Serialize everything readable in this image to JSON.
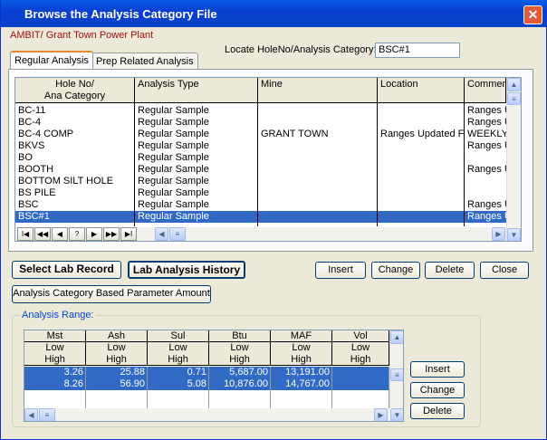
{
  "window": {
    "title": "Browse the Analysis Category File",
    "close_glyph": "✕"
  },
  "plant": "AMBIT/ Grant Town Power Plant",
  "locate": {
    "label": "Locate HoleNo/Analysis Category:",
    "value": "BSC#1"
  },
  "tabs": [
    "Regular Analysis",
    "Prep Related Analysis"
  ],
  "table": {
    "headers": {
      "hole_line1": "Hole No/",
      "hole_line2": "Ana Category",
      "type": "Analysis Type",
      "mine": "Mine",
      "location": "Location",
      "comments": "Commen"
    },
    "rows": [
      {
        "hole": "BC-11",
        "type": "Regular Sample",
        "mine": "",
        "location": "",
        "comments": "Ranges U"
      },
      {
        "hole": "BC-4",
        "type": "Regular Sample",
        "mine": "",
        "location": "",
        "comments": "Ranges U"
      },
      {
        "hole": "BC-4 COMP",
        "type": "Regular Sample",
        "mine": "GRANT TOWN",
        "location": "Ranges Updated F",
        "comments": "WEEKLY"
      },
      {
        "hole": "BKVS",
        "type": "Regular Sample",
        "mine": "",
        "location": "",
        "comments": "Ranges U"
      },
      {
        "hole": "BO",
        "type": "Regular Sample",
        "mine": "",
        "location": "",
        "comments": ""
      },
      {
        "hole": "BOOTH",
        "type": "Regular Sample",
        "mine": "",
        "location": "",
        "comments": "Ranges U"
      },
      {
        "hole": "BOTTOM SILT HOLE",
        "type": "Regular Sample",
        "mine": "",
        "location": "",
        "comments": ""
      },
      {
        "hole": "BS PILE",
        "type": "Regular Sample",
        "mine": "",
        "location": "",
        "comments": ""
      },
      {
        "hole": "BSC",
        "type": "Regular Sample",
        "mine": "",
        "location": "",
        "comments": "Ranges U"
      },
      {
        "hole": "BSC#1",
        "type": "Regular Sample",
        "mine": "",
        "location": "",
        "comments": "Ranges U"
      }
    ],
    "nav": [
      "I◀",
      "◀◀",
      "◀",
      "?",
      "▶",
      "▶▶",
      "▶I"
    ]
  },
  "buttons": {
    "select_lab": "Select Lab Record",
    "lab_history": "Lab Analysis History",
    "insert": "Insert",
    "change": "Change",
    "delete": "Delete",
    "close": "Close",
    "category_param": "Analysis Category Based Parameter Amount"
  },
  "range": {
    "legend": "Analysis Range:",
    "columns": [
      "Mst",
      "Ash",
      "Sul",
      "Btu",
      "MAF",
      "Vol"
    ],
    "sub": [
      "Low",
      "High"
    ],
    "rows": [
      [
        "3.26",
        "25.88",
        "0.71",
        "5,687.00",
        "13,191.00",
        ""
      ],
      [
        "8.26",
        "56.90",
        "5.08",
        "10,876.00",
        "14,767.00",
        ""
      ]
    ],
    "insert": "Insert",
    "change": "Change",
    "delete": "Delete"
  },
  "icons": {
    "title": "warning-triangle-icon",
    "close": "close-icon"
  }
}
